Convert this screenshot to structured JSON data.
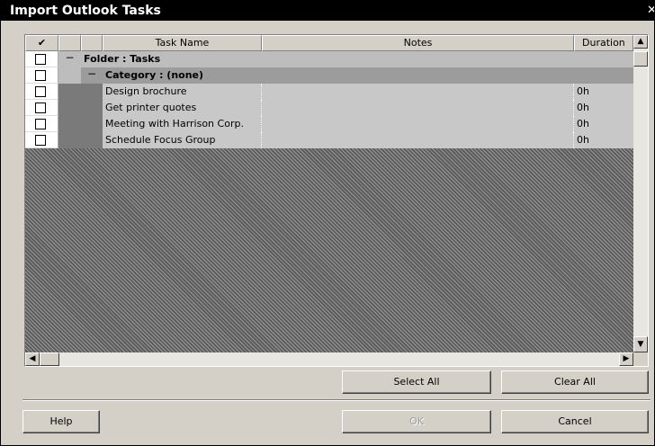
{
  "dialog": {
    "title": "Import Outlook Tasks",
    "close_glyph": "✕"
  },
  "table": {
    "headers": {
      "check": "✔",
      "task_name": "Task Name",
      "notes": "Notes",
      "duration": "Duration"
    },
    "folder_row": {
      "expander": "−",
      "label": "Folder : Tasks"
    },
    "category_row": {
      "expander": "−",
      "label": "Category : (none)"
    },
    "tasks": [
      {
        "name": "Design brochure",
        "notes": "",
        "duration": "0h",
        "checked": false
      },
      {
        "name": "Get printer quotes",
        "notes": "",
        "duration": "0h",
        "checked": false
      },
      {
        "name": "Meeting with Harrison Corp.",
        "notes": "",
        "duration": "0h",
        "checked": false
      },
      {
        "name": "Schedule Focus Group",
        "notes": "",
        "duration": "0h",
        "checked": false
      }
    ]
  },
  "scroll_glyphs": {
    "up": "▲",
    "down": "▼",
    "left": "◀",
    "right": "▶"
  },
  "buttons": {
    "select_all": "Select All",
    "clear_all": "Clear All",
    "help": "Help",
    "ok": "OK",
    "cancel": "Cancel"
  }
}
